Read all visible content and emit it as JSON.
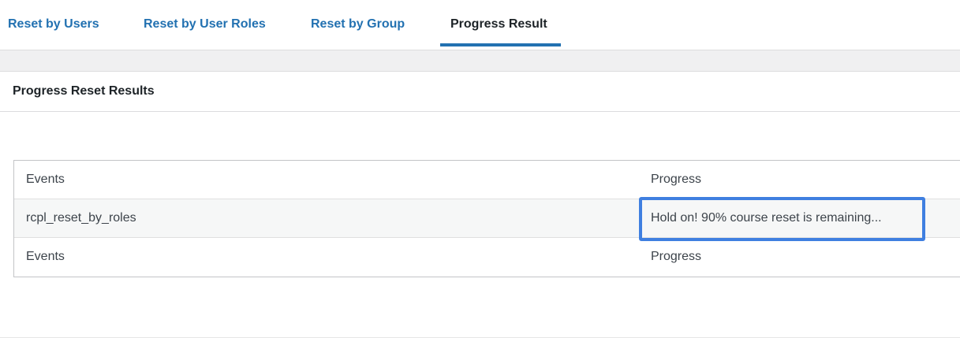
{
  "tabs": [
    {
      "label": "Reset by Users",
      "active": false
    },
    {
      "label": "Reset by User Roles",
      "active": false
    },
    {
      "label": "Reset by Group",
      "active": false
    },
    {
      "label": "Progress Result",
      "active": true
    }
  ],
  "section": {
    "title": "Progress Reset Results"
  },
  "table": {
    "header": {
      "events": "Events",
      "progress": "Progress"
    },
    "rows": [
      {
        "events": "rcpl_reset_by_roles",
        "progress": "Hold on! 90% course reset is remaining..."
      }
    ],
    "footer": {
      "events": "Events",
      "progress": "Progress"
    }
  },
  "colors": {
    "accent": "#2271b1",
    "highlight": "#3f7fe0"
  }
}
